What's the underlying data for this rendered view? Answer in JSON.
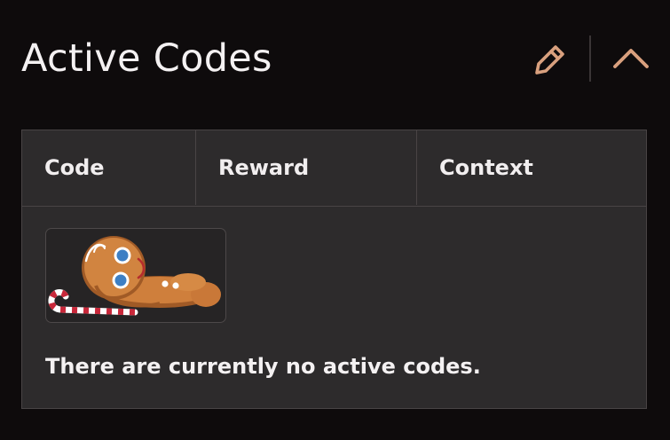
{
  "header": {
    "title": "Active Codes",
    "edit_icon": "pencil-icon",
    "collapse_icon": "chevron-up-icon",
    "accent_color": "#d9a07e"
  },
  "table": {
    "columns": [
      "Code",
      "Reward",
      "Context"
    ],
    "empty_image": "sleeping-gingerbread-cookie-with-candy-cane",
    "empty_message": "There are currently no active codes."
  }
}
